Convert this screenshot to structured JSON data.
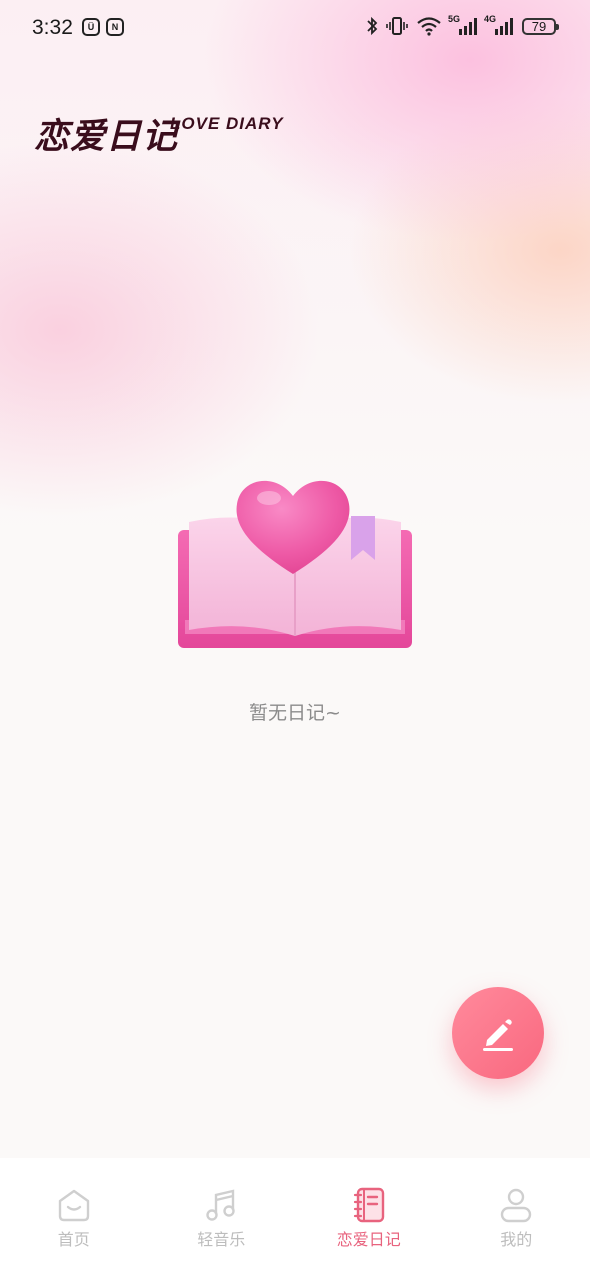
{
  "status_bar": {
    "time": "3:32",
    "battery": "79",
    "signal_5g": "5G",
    "signal_4g": "4G"
  },
  "header": {
    "title_cn": "恋爱日记",
    "title_en": "LOVE DIARY"
  },
  "empty_state": {
    "message": "暂无日记~"
  },
  "tabs": [
    {
      "label": "首页",
      "icon": "home-icon",
      "active": false
    },
    {
      "label": "轻音乐",
      "icon": "music-note-icon",
      "active": false
    },
    {
      "label": "恋爱日记",
      "icon": "diary-notebook-icon",
      "active": true
    },
    {
      "label": "我的",
      "icon": "user-profile-icon",
      "active": false
    }
  ],
  "colors": {
    "accent": "#e8637e",
    "fab": "#f9687f",
    "title": "#3a0d1c",
    "inactive_tab": "#bdbdbd"
  }
}
